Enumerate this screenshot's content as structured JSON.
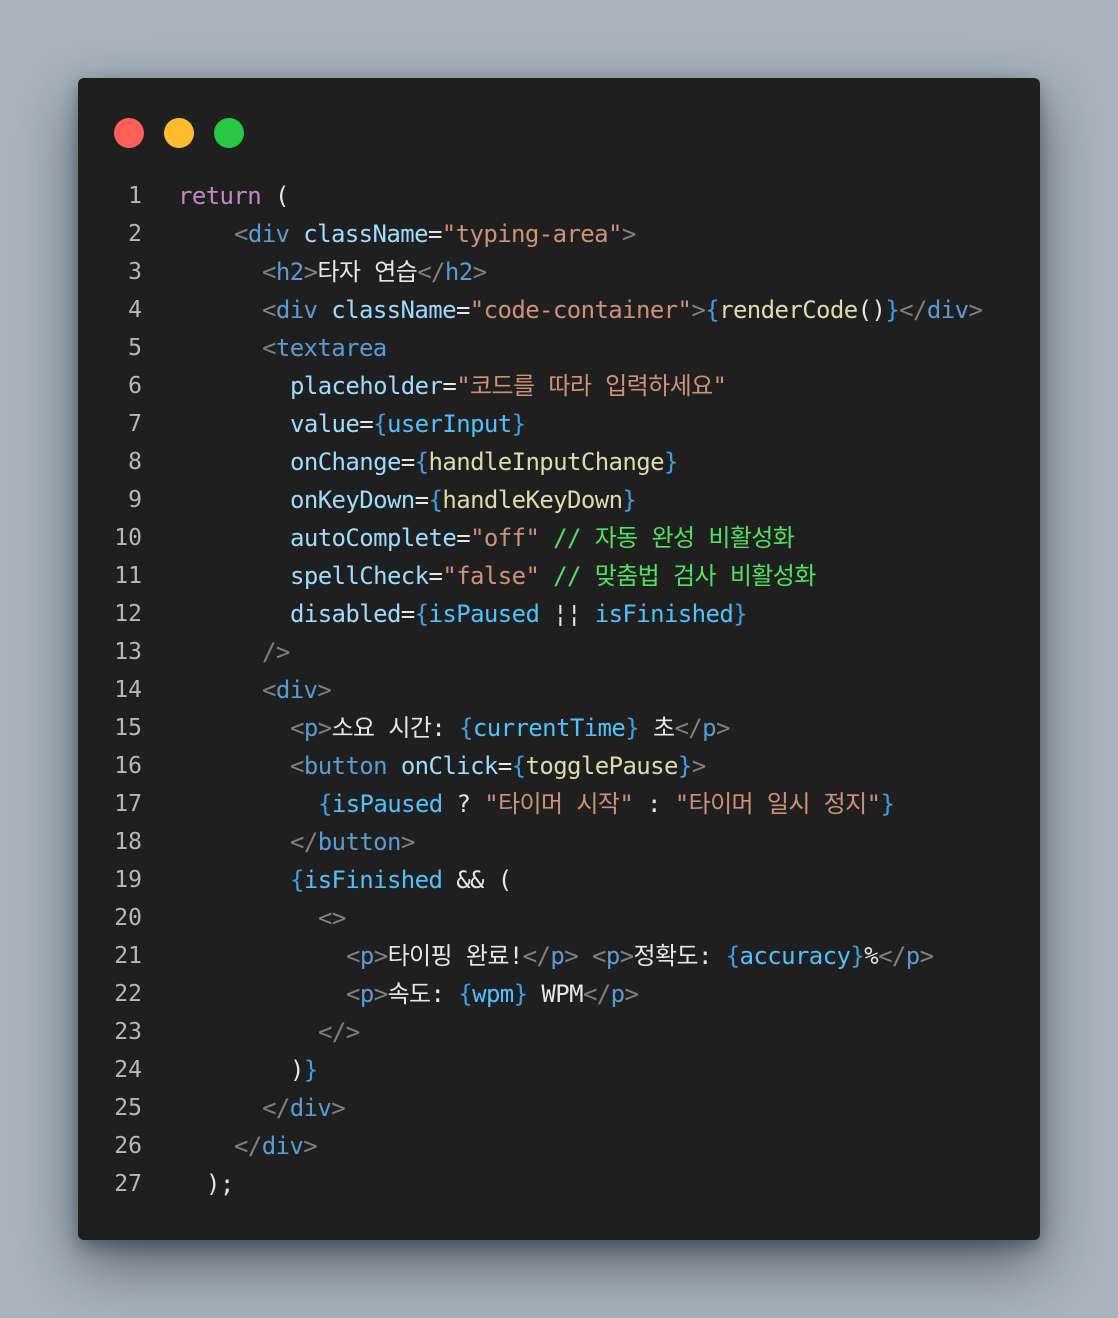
{
  "colors": {
    "page_background": "#a8b3be",
    "editor_background": "#1f1f1f",
    "close": "#ff5f57",
    "minimize": "#febc2e",
    "maximize": "#28c840",
    "line_number": "#b8b8b8",
    "keyword": "#c586c0",
    "punctuation": "#808080",
    "tag": "#569cd6",
    "attribute": "#9cdcfe",
    "string": "#ce9178",
    "brace": "#3d9ee8",
    "function": "#dcdcaa",
    "variable": "#4fc1ff",
    "comment": "#4ee25e",
    "text": "#e6e6e6"
  },
  "window_controls": [
    {
      "name": "close-button",
      "icon": "close-dot",
      "color": "#ff5f57"
    },
    {
      "name": "minimize-button",
      "icon": "minimize-dot",
      "color": "#febc2e"
    },
    {
      "name": "maximize-button",
      "icon": "maximize-dot",
      "color": "#28c840"
    }
  ],
  "code": {
    "lines": [
      {
        "n": "1",
        "indent": "",
        "tokens": [
          [
            "kw",
            "return"
          ],
          [
            "tx",
            " ("
          ]
        ]
      },
      {
        "n": "2",
        "indent": "  ",
        "tokens": [
          [
            "pu",
            "<"
          ],
          [
            "tag",
            "div"
          ],
          [
            "tx",
            " "
          ],
          [
            "attr",
            "className"
          ],
          [
            "tx",
            "="
          ],
          [
            "str",
            "\"typing-area\""
          ],
          [
            "pu",
            ">"
          ]
        ]
      },
      {
        "n": "3",
        "indent": "   ",
        "tokens": [
          [
            "pu",
            "<"
          ],
          [
            "tag",
            "h2"
          ],
          [
            "pu",
            ">"
          ],
          [
            "tx",
            "타자 연습"
          ],
          [
            "pu",
            "</"
          ],
          [
            "tag",
            "h2"
          ],
          [
            "pu",
            ">"
          ]
        ]
      },
      {
        "n": "4",
        "indent": "   ",
        "tokens": [
          [
            "pu",
            "<"
          ],
          [
            "tag",
            "div"
          ],
          [
            "tx",
            " "
          ],
          [
            "attr",
            "className"
          ],
          [
            "tx",
            "="
          ],
          [
            "str",
            "\"code-container\""
          ],
          [
            "pu",
            ">"
          ],
          [
            "br",
            "{"
          ],
          [
            "fn",
            "renderCode"
          ],
          [
            "tx",
            "()"
          ],
          [
            "br",
            "}"
          ],
          [
            "pu",
            "</"
          ],
          [
            "tag",
            "div"
          ],
          [
            "pu",
            ">"
          ]
        ]
      },
      {
        "n": "5",
        "indent": "   ",
        "tokens": [
          [
            "pu",
            "<"
          ],
          [
            "tag",
            "textarea"
          ]
        ]
      },
      {
        "n": "6",
        "indent": "    ",
        "tokens": [
          [
            "attr",
            "placeholder"
          ],
          [
            "tx",
            "="
          ],
          [
            "str",
            "\"코드를 따라 입력하세요\""
          ]
        ]
      },
      {
        "n": "7",
        "indent": "    ",
        "tokens": [
          [
            "attr",
            "value"
          ],
          [
            "tx",
            "="
          ],
          [
            "br",
            "{"
          ],
          [
            "var",
            "userInput"
          ],
          [
            "br",
            "}"
          ]
        ]
      },
      {
        "n": "8",
        "indent": "    ",
        "tokens": [
          [
            "attr",
            "onChange"
          ],
          [
            "tx",
            "="
          ],
          [
            "br",
            "{"
          ],
          [
            "fn",
            "handleInputChange"
          ],
          [
            "br",
            "}"
          ]
        ]
      },
      {
        "n": "9",
        "indent": "    ",
        "tokens": [
          [
            "attr",
            "onKeyDown"
          ],
          [
            "tx",
            "="
          ],
          [
            "br",
            "{"
          ],
          [
            "fn",
            "handleKeyDown"
          ],
          [
            "br",
            "}"
          ]
        ]
      },
      {
        "n": "10",
        "indent": "    ",
        "tokens": [
          [
            "attr",
            "autoComplete"
          ],
          [
            "tx",
            "="
          ],
          [
            "str",
            "\"off\""
          ],
          [
            "tx",
            " "
          ],
          [
            "cm",
            "// 자동 완성 비활성화"
          ]
        ]
      },
      {
        "n": "11",
        "indent": "    ",
        "tokens": [
          [
            "attr",
            "spellCheck"
          ],
          [
            "tx",
            "="
          ],
          [
            "str",
            "\"false\""
          ],
          [
            "tx",
            " "
          ],
          [
            "cm",
            "// 맞춤법 검사 비활성화"
          ]
        ]
      },
      {
        "n": "12",
        "indent": "    ",
        "tokens": [
          [
            "attr",
            "disabled"
          ],
          [
            "tx",
            "="
          ],
          [
            "br",
            "{"
          ],
          [
            "var",
            "isPaused"
          ],
          [
            "tx",
            " ¦¦ "
          ],
          [
            "var",
            "isFinished"
          ],
          [
            "br",
            "}"
          ]
        ]
      },
      {
        "n": "13",
        "indent": "   ",
        "tokens": [
          [
            "pu",
            "/>"
          ]
        ]
      },
      {
        "n": "14",
        "indent": "   ",
        "tokens": [
          [
            "pu",
            "<"
          ],
          [
            "tag",
            "div"
          ],
          [
            "pu",
            ">"
          ]
        ]
      },
      {
        "n": "15",
        "indent": "    ",
        "tokens": [
          [
            "pu",
            "<"
          ],
          [
            "tag",
            "p"
          ],
          [
            "pu",
            ">"
          ],
          [
            "tx",
            "소요 시간: "
          ],
          [
            "br",
            "{"
          ],
          [
            "var",
            "currentTime"
          ],
          [
            "br",
            "}"
          ],
          [
            "tx",
            " 초"
          ],
          [
            "pu",
            "</"
          ],
          [
            "tag",
            "p"
          ],
          [
            "pu",
            ">"
          ]
        ]
      },
      {
        "n": "16",
        "indent": "    ",
        "tokens": [
          [
            "pu",
            "<"
          ],
          [
            "tag",
            "button"
          ],
          [
            "tx",
            " "
          ],
          [
            "attr",
            "onClick"
          ],
          [
            "tx",
            "="
          ],
          [
            "br",
            "{"
          ],
          [
            "fn",
            "togglePause"
          ],
          [
            "br",
            "}"
          ],
          [
            "pu",
            ">"
          ]
        ]
      },
      {
        "n": "17",
        "indent": "     ",
        "tokens": [
          [
            "br",
            "{"
          ],
          [
            "var",
            "isPaused"
          ],
          [
            "tx",
            " ? "
          ],
          [
            "str",
            "\"타이머 시작\""
          ],
          [
            "tx",
            " : "
          ],
          [
            "str",
            "\"타이머 일시 정지\""
          ],
          [
            "br",
            "}"
          ]
        ]
      },
      {
        "n": "18",
        "indent": "    ",
        "tokens": [
          [
            "pu",
            "</"
          ],
          [
            "tag",
            "button"
          ],
          [
            "pu",
            ">"
          ]
        ]
      },
      {
        "n": "19",
        "indent": "    ",
        "tokens": [
          [
            "br",
            "{"
          ],
          [
            "var",
            "isFinished"
          ],
          [
            "tx",
            " && ("
          ]
        ]
      },
      {
        "n": "20",
        "indent": "     ",
        "tokens": [
          [
            "pu",
            "<>"
          ]
        ]
      },
      {
        "n": "21",
        "indent": "      ",
        "tokens": [
          [
            "pu",
            "<"
          ],
          [
            "tag",
            "p"
          ],
          [
            "pu",
            ">"
          ],
          [
            "tx",
            "타이핑 완료!"
          ],
          [
            "pu",
            "</"
          ],
          [
            "tag",
            "p"
          ],
          [
            "pu",
            ">"
          ],
          [
            "tx",
            " "
          ],
          [
            "pu",
            "<"
          ],
          [
            "tag",
            "p"
          ],
          [
            "pu",
            ">"
          ],
          [
            "tx",
            "정확도: "
          ],
          [
            "br",
            "{"
          ],
          [
            "var",
            "accuracy"
          ],
          [
            "br",
            "}"
          ],
          [
            "tx",
            "%"
          ],
          [
            "pu",
            "</"
          ],
          [
            "tag",
            "p"
          ],
          [
            "pu",
            ">"
          ]
        ]
      },
      {
        "n": "22",
        "indent": "      ",
        "tokens": [
          [
            "pu",
            "<"
          ],
          [
            "tag",
            "p"
          ],
          [
            "pu",
            ">"
          ],
          [
            "tx",
            "속도: "
          ],
          [
            "br",
            "{"
          ],
          [
            "var",
            "wpm"
          ],
          [
            "br",
            "}"
          ],
          [
            "tx",
            " WPM"
          ],
          [
            "pu",
            "</"
          ],
          [
            "tag",
            "p"
          ],
          [
            "pu",
            ">"
          ]
        ]
      },
      {
        "n": "23",
        "indent": "     ",
        "tokens": [
          [
            "pu",
            "</>"
          ]
        ]
      },
      {
        "n": "24",
        "indent": "    ",
        "tokens": [
          [
            "tx",
            ")"
          ],
          [
            "br",
            "}"
          ]
        ]
      },
      {
        "n": "25",
        "indent": "   ",
        "tokens": [
          [
            "pu",
            "</"
          ],
          [
            "tag",
            "div"
          ],
          [
            "pu",
            ">"
          ]
        ]
      },
      {
        "n": "26",
        "indent": "  ",
        "tokens": [
          [
            "pu",
            "</"
          ],
          [
            "tag",
            "div"
          ],
          [
            "pu",
            ">"
          ]
        ]
      },
      {
        "n": "27",
        "indent": " ",
        "tokens": [
          [
            "tx",
            ");"
          ]
        ]
      }
    ]
  }
}
